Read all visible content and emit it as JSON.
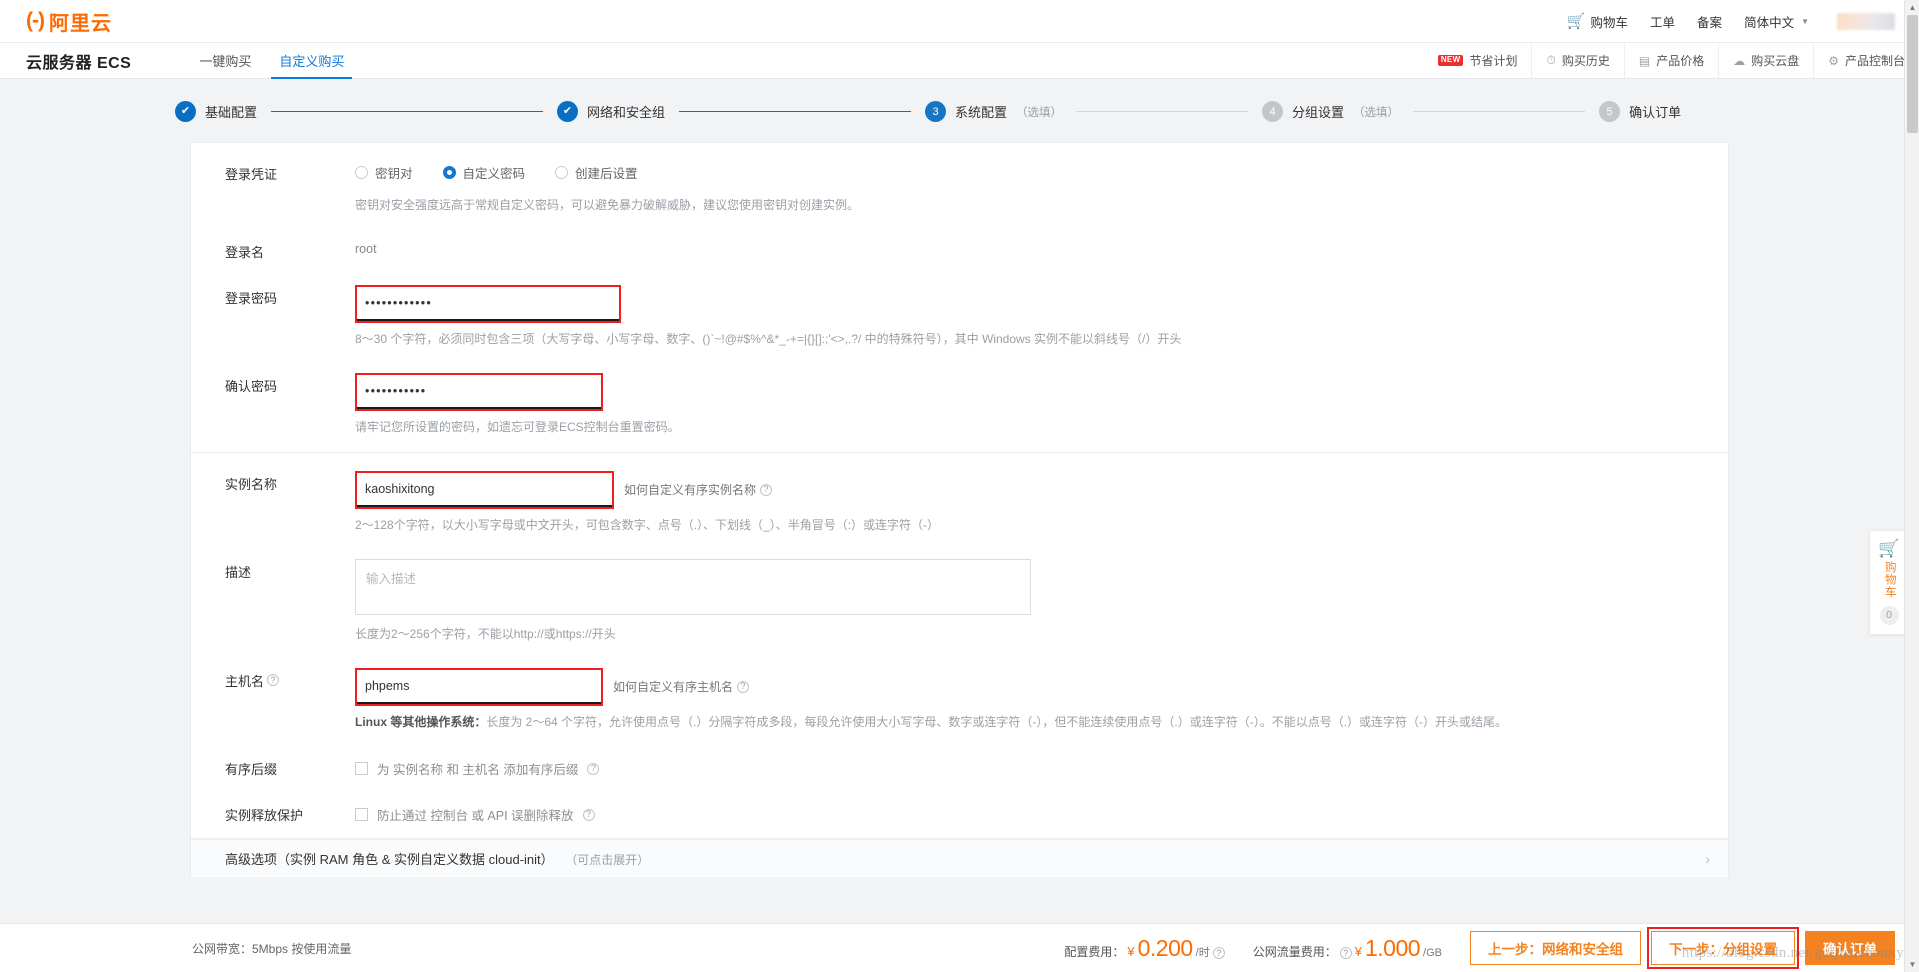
{
  "topbar": {
    "logo_mark": "(-)",
    "logo_text": "阿里云",
    "nav": [
      {
        "label": "购物车",
        "icon": "cart-icon"
      },
      {
        "label": "工单",
        "icon": ""
      },
      {
        "label": "备案",
        "icon": ""
      },
      {
        "label": "简体中文",
        "icon": "chevron-down-icon"
      }
    ]
  },
  "prodbar": {
    "title": "云服务器 ECS",
    "tabs": [
      {
        "label": "一键购买",
        "active": false
      },
      {
        "label": "自定义购买",
        "active": true
      }
    ],
    "links": [
      {
        "label": "节省计划",
        "badge": "NEW",
        "icon": "new-badge-icon"
      },
      {
        "label": "购买历史",
        "icon": "clock-icon"
      },
      {
        "label": "产品价格",
        "icon": "list-icon"
      },
      {
        "label": "购买云盘",
        "icon": "disk-icon"
      },
      {
        "label": "产品控制台",
        "icon": "gear-icon"
      }
    ]
  },
  "steps": [
    {
      "num": "✔",
      "label": "基础配置",
      "optional": "",
      "state": "done"
    },
    {
      "num": "✔",
      "label": "网络和安全组",
      "optional": "",
      "state": "done"
    },
    {
      "num": "3",
      "label": "系统配置",
      "optional": "（选填）",
      "state": "current"
    },
    {
      "num": "4",
      "label": "分组设置",
      "optional": "（选填）",
      "state": "todo"
    },
    {
      "num": "5",
      "label": "确认订单",
      "optional": "",
      "state": "todo"
    }
  ],
  "form": {
    "credential": {
      "label": "登录凭证",
      "options": [
        {
          "label": "密钥对",
          "selected": false
        },
        {
          "label": "自定义密码",
          "selected": true
        },
        {
          "label": "创建后设置",
          "selected": false
        }
      ],
      "hint": "密钥对安全强度远高于常规自定义密码，可以避免暴力破解威胁，建议您使用密钥对创建实例。"
    },
    "login_name": {
      "label": "登录名",
      "value": "root"
    },
    "password": {
      "label": "登录密码",
      "value": "••••••••••••",
      "hint": "8～30 个字符，必须同时包含三项（大写字母、小写字母、数字、()`~!@#$%^&*_-+=|{}[]:;'<>,.?/ 中的特殊符号），其中 Windows 实例不能以斜线号（/）开头"
    },
    "confirm_password": {
      "label": "确认密码",
      "value": "•••••••••••",
      "hint": "请牢记您所设置的密码，如遗忘可登录ECS控制台重置密码。"
    },
    "instance_name": {
      "label": "实例名称",
      "value": "kaoshixitong",
      "aside": "如何自定义有序实例名称",
      "hint": "2～128个字符，以大小写字母或中文开头，可包含数字、点号（.）、下划线（_）、半角冒号（:）或连字符（-）"
    },
    "description": {
      "label": "描述",
      "value": "",
      "placeholder": "输入描述",
      "hint": "长度为2～256个字符，不能以http://或https://开头"
    },
    "hostname": {
      "label": "主机名",
      "value": "phpems",
      "aside": "如何自定义有序主机名",
      "hint_bold": "Linux 等其他操作系统：",
      "hint": "长度为 2～64 个字符，允许使用点号（.）分隔字符成多段，每段允许使用大小写字母、数字或连字符（-），但不能连续使用点号（.）或连字符（-）。不能以点号（.）或连字符（-）开头或结尾。"
    },
    "ordered_suffix": {
      "label": "有序后缀",
      "checkbox_label": "为 实例名称 和 主机名 添加有序后缀",
      "checked": false
    },
    "release_protection": {
      "label": "实例释放保护",
      "checkbox_label": "防止通过 控制台 或 API 误删除释放",
      "checked": false
    },
    "advanced": {
      "title": "高级选项（实例 RAM 角色 & 实例自定义数据 cloud-init）",
      "sub": "（可点击展开）"
    }
  },
  "footer": {
    "bandwidth": "公网带宽：5Mbps 按使用流量",
    "config_fee_label": "配置费用：",
    "config_fee_yen": "¥",
    "config_fee_amount": "0.200",
    "config_fee_unit": "/时",
    "traffic_fee_label": "公网流量费用：",
    "traffic_fee_yen": "¥",
    "traffic_fee_amount": "1.000",
    "traffic_fee_unit": "/GB",
    "prev_button": "上一步：网络和安全组",
    "next_button": "下一步：分组设置",
    "confirm_button": "确认订单",
    "watermark": "https://blog.csdn.net/guijianchouxyz"
  },
  "floating_cart": {
    "label": "购物车",
    "count": "0"
  },
  "colors": {
    "accent_orange": "#f58220",
    "link_blue": "#0a7ae0",
    "step_blue": "#0a6fc2",
    "highlight_red": "#ee1f1f"
  }
}
